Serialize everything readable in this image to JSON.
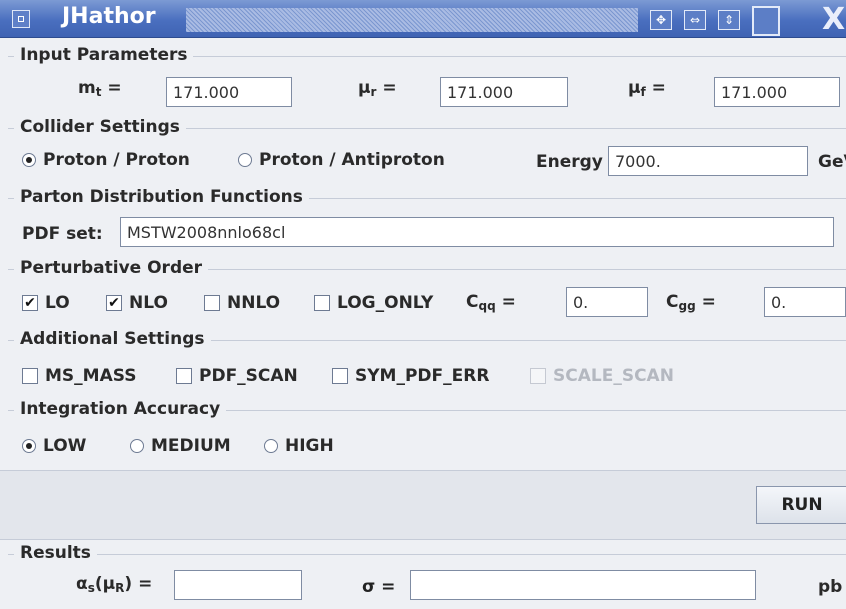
{
  "window": {
    "title": "JHathor"
  },
  "input_parameters": {
    "legend": "Input Parameters",
    "mt": {
      "label": "m",
      "sub": "t",
      "eq": "=",
      "value": "171.000"
    },
    "mur": {
      "label": "μ",
      "sub": "r",
      "eq": "=",
      "value": "171.000"
    },
    "muf": {
      "label": "μ",
      "sub": "f",
      "eq": "=",
      "value": "171.000"
    }
  },
  "collider": {
    "legend": "Collider Settings",
    "options": [
      "Proton / Proton",
      "Proton / Antiproton"
    ],
    "selected": "Proton / Proton",
    "energy_label": "Energy =",
    "energy_value": "7000.",
    "energy_unit": "GeV"
  },
  "pdf": {
    "legend": "Parton Distribution Functions",
    "label": "PDF set:",
    "value": "MSTW2008nnlo68cl"
  },
  "order": {
    "legend": "Perturbative Order",
    "lo": "LO",
    "nlo": "NLO",
    "nnlo": "NNLO",
    "log_only": "LOG_ONLY",
    "cqq": {
      "label": "C",
      "sub": "qq",
      "eq": "=",
      "value": "0."
    },
    "cgg": {
      "label": "C",
      "sub": "gg",
      "eq": "=",
      "value": "0."
    }
  },
  "additional": {
    "legend": "Additional Settings",
    "ms_mass": "MS_MASS",
    "pdf_scan": "PDF_SCAN",
    "sym_pdf_err": "SYM_PDF_ERR",
    "scale_scan": "SCALE_SCAN"
  },
  "accuracy": {
    "legend": "Integration Accuracy",
    "low": "LOW",
    "medium": "MEDIUM",
    "high": "HIGH",
    "selected": "LOW"
  },
  "run_label": "RUN",
  "results": {
    "legend": "Results",
    "alpha_label": "α",
    "alpha_sub": "s",
    "alpha_arg": "(μ",
    "alpha_arg_sub": "R",
    "alpha_tail": ") =",
    "alpha_value": "",
    "sigma_label": "σ =",
    "sigma_value": "",
    "unit": "pb"
  }
}
